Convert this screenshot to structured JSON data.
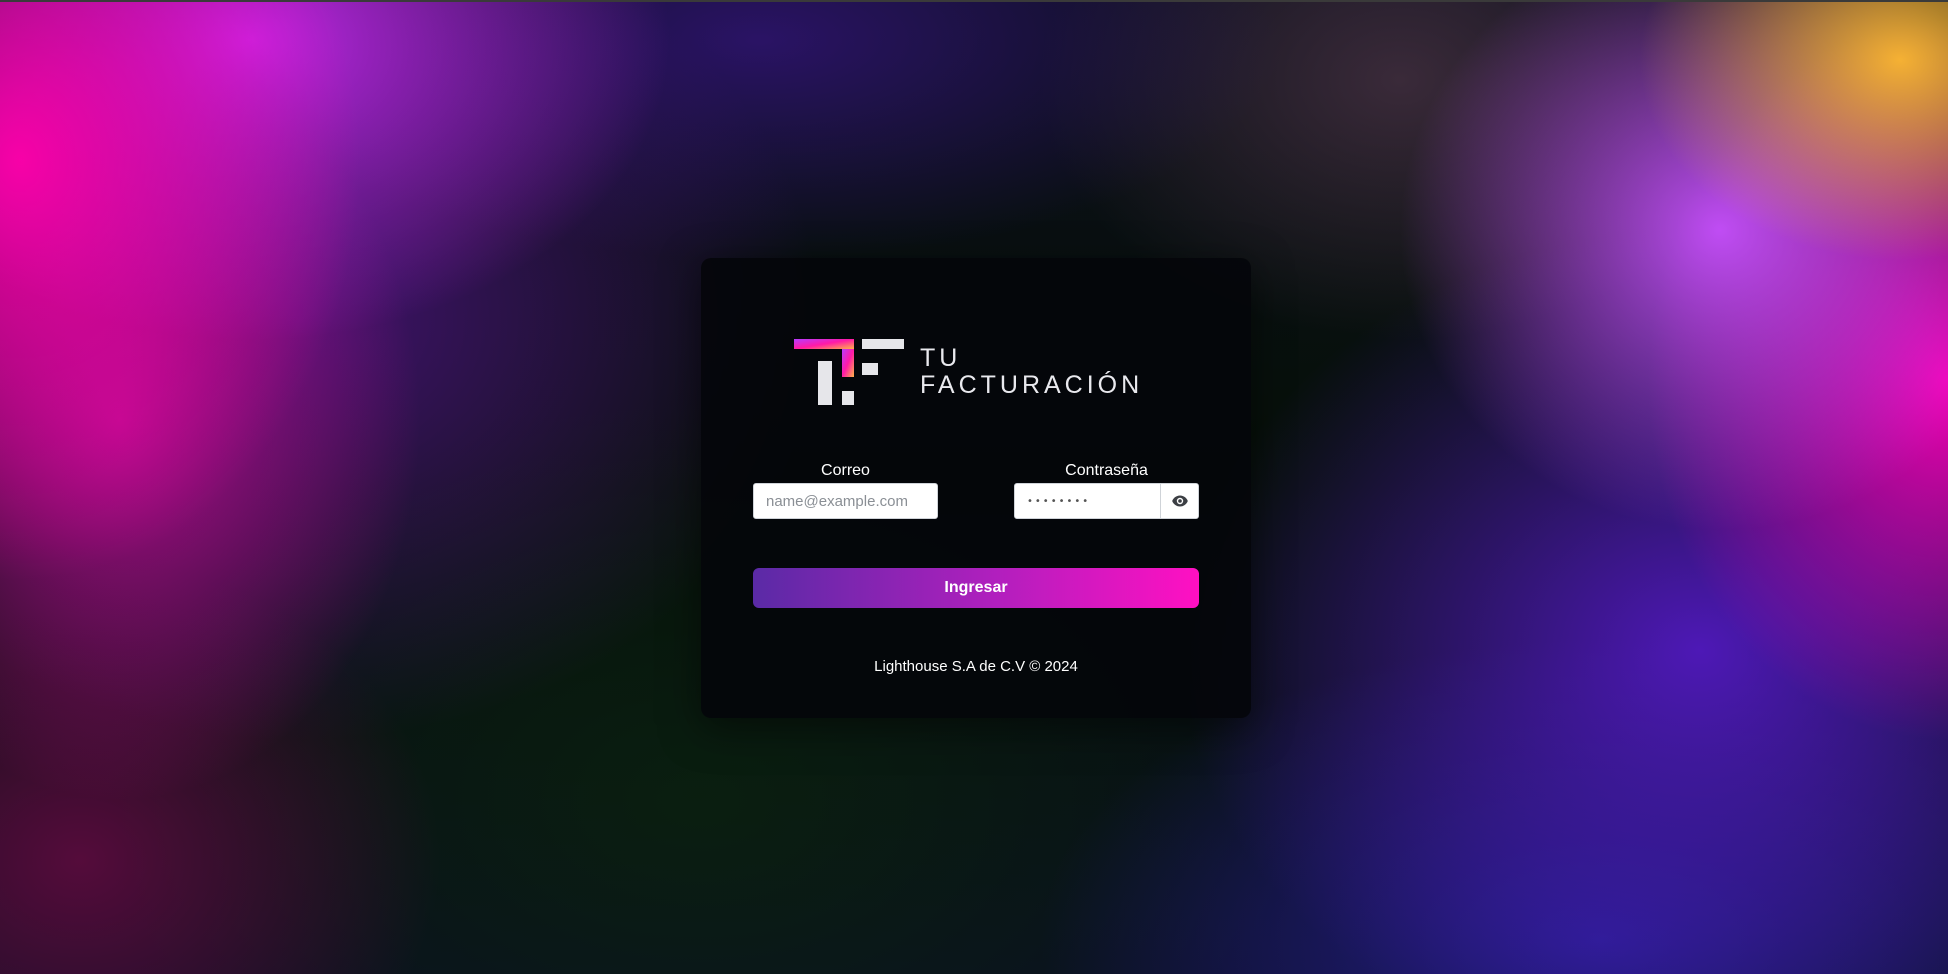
{
  "logo": {
    "line1": "TU",
    "line2": "FACTURACIÓN",
    "icon": "tf-logo-mark"
  },
  "form": {
    "email_label": "Correo",
    "email_placeholder": "name@example.com",
    "password_label": "Contraseña",
    "password_value": "••••••••",
    "show_password_icon": "eye-icon",
    "submit_label": "Ingresar"
  },
  "footer": {
    "text": "Lighthouse S.A de C.V © 2024"
  },
  "colors": {
    "button_start": "#5a2aa6",
    "button_end": "#ff10c2",
    "card_bg": "#04060a"
  }
}
